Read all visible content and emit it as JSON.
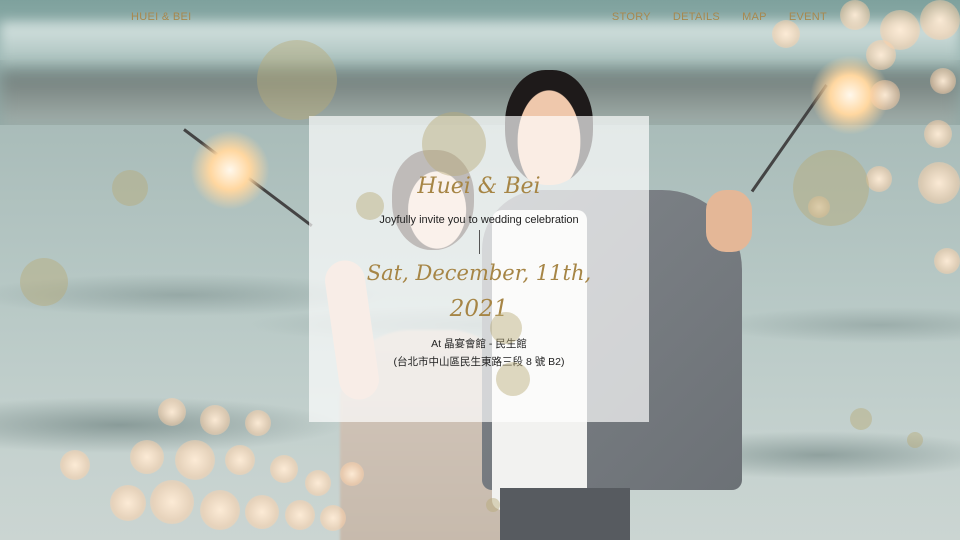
{
  "nav": {
    "brand": "HUEI & BEI",
    "links": [
      "STORY",
      "DETAILS",
      "MAP",
      "EVENT"
    ]
  },
  "invitation": {
    "couple": "Huei & Bei",
    "tagline": "Joyfully invite you to wedding celebration",
    "date_line": "Sat, December, 11th,",
    "year": "2021",
    "venue": "At 晶宴會館 - 民生館",
    "address": "(台北市中山區民生東路三段 8 號 B2)"
  },
  "colors": {
    "accent_gold": "#a8884e",
    "card_overlay": "rgba(255,255,255,0.68)",
    "body_text": "#222222"
  },
  "background": {
    "photo_subject": "couple holding sparklers on beach",
    "icons": [
      "sparkler-icon",
      "bokeh-light-icon"
    ]
  }
}
